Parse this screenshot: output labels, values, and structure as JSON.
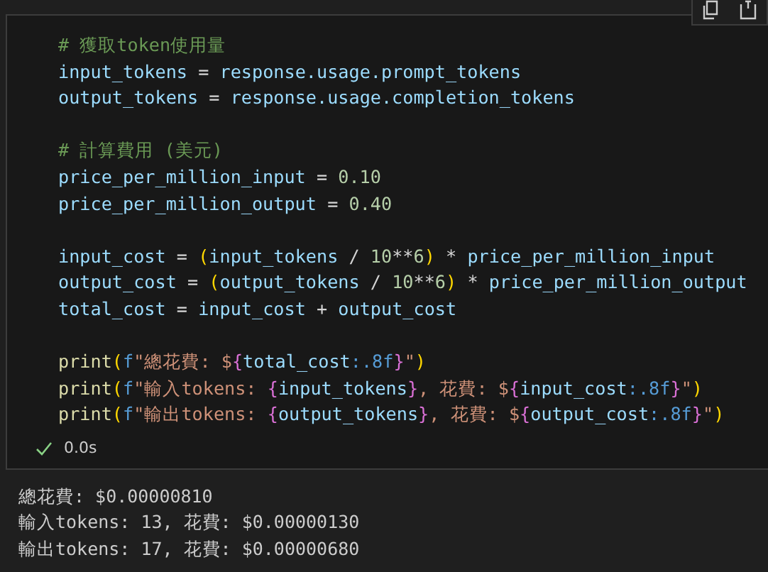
{
  "cell": {
    "blocks": [
      [
        [
          {
            "kind": "comment",
            "text": "# 獲取token使用量"
          }
        ],
        [
          {
            "kind": "name",
            "text": "input_tokens"
          },
          {
            "kind": "op",
            "text": " = "
          },
          {
            "kind": "name",
            "text": "response.usage.prompt_tokens"
          }
        ],
        [
          {
            "kind": "name",
            "text": "output_tokens"
          },
          {
            "kind": "op",
            "text": " = "
          },
          {
            "kind": "name",
            "text": "response.usage.completion_tokens"
          }
        ]
      ],
      [
        [
          {
            "kind": "comment",
            "text": "# 計算費用 (美元)"
          }
        ],
        [
          {
            "kind": "name",
            "text": "price_per_million_input"
          },
          {
            "kind": "op",
            "text": " = "
          },
          {
            "kind": "number",
            "text": "0.10"
          }
        ],
        [
          {
            "kind": "name",
            "text": "price_per_million_output"
          },
          {
            "kind": "op",
            "text": " = "
          },
          {
            "kind": "number",
            "text": "0.40"
          }
        ]
      ],
      [
        [
          {
            "kind": "name",
            "text": "input_cost"
          },
          {
            "kind": "op",
            "text": " = "
          },
          {
            "kind": "paren",
            "text": "("
          },
          {
            "kind": "name",
            "text": "input_tokens"
          },
          {
            "kind": "op",
            "text": " / "
          },
          {
            "kind": "number",
            "text": "10"
          },
          {
            "kind": "op",
            "text": "**"
          },
          {
            "kind": "number",
            "text": "6"
          },
          {
            "kind": "paren",
            "text": ")"
          },
          {
            "kind": "op",
            "text": " * "
          },
          {
            "kind": "name",
            "text": "price_per_million_input"
          }
        ],
        [
          {
            "kind": "name",
            "text": "output_cost"
          },
          {
            "kind": "op",
            "text": " = "
          },
          {
            "kind": "paren",
            "text": "("
          },
          {
            "kind": "name",
            "text": "output_tokens"
          },
          {
            "kind": "op",
            "text": " / "
          },
          {
            "kind": "number",
            "text": "10"
          },
          {
            "kind": "op",
            "text": "**"
          },
          {
            "kind": "number",
            "text": "6"
          },
          {
            "kind": "paren",
            "text": ")"
          },
          {
            "kind": "op",
            "text": " * "
          },
          {
            "kind": "name",
            "text": "price_per_million_output"
          }
        ],
        [
          {
            "kind": "name",
            "text": "total_cost"
          },
          {
            "kind": "op",
            "text": " = "
          },
          {
            "kind": "name",
            "text": "input_cost"
          },
          {
            "kind": "op",
            "text": " + "
          },
          {
            "kind": "name",
            "text": "output_cost"
          }
        ]
      ],
      [
        [
          {
            "kind": "func",
            "text": "print"
          },
          {
            "kind": "paren",
            "text": "("
          },
          {
            "kind": "prefix",
            "text": "f"
          },
          {
            "kind": "string",
            "text": "\"總花費: $"
          },
          {
            "kind": "brace",
            "text": "{"
          },
          {
            "kind": "name",
            "text": "total_cost"
          },
          {
            "kind": "spec",
            "text": ":.8f"
          },
          {
            "kind": "brace",
            "text": "}"
          },
          {
            "kind": "string",
            "text": "\""
          },
          {
            "kind": "paren",
            "text": ")"
          }
        ],
        [
          {
            "kind": "func",
            "text": "print"
          },
          {
            "kind": "paren",
            "text": "("
          },
          {
            "kind": "prefix",
            "text": "f"
          },
          {
            "kind": "string",
            "text": "\"輸入tokens: "
          },
          {
            "kind": "brace",
            "text": "{"
          },
          {
            "kind": "name",
            "text": "input_tokens"
          },
          {
            "kind": "brace",
            "text": "}"
          },
          {
            "kind": "string",
            "text": ", 花費: $"
          },
          {
            "kind": "brace",
            "text": "{"
          },
          {
            "kind": "name",
            "text": "input_cost"
          },
          {
            "kind": "spec",
            "text": ":.8f"
          },
          {
            "kind": "brace",
            "text": "}"
          },
          {
            "kind": "string",
            "text": "\""
          },
          {
            "kind": "paren",
            "text": ")"
          }
        ],
        [
          {
            "kind": "func",
            "text": "print"
          },
          {
            "kind": "paren",
            "text": "("
          },
          {
            "kind": "prefix",
            "text": "f"
          },
          {
            "kind": "string",
            "text": "\"輸出tokens: "
          },
          {
            "kind": "brace",
            "text": "{"
          },
          {
            "kind": "name",
            "text": "output_tokens"
          },
          {
            "kind": "brace",
            "text": "}"
          },
          {
            "kind": "string",
            "text": ", 花費: $"
          },
          {
            "kind": "brace",
            "text": "{"
          },
          {
            "kind": "name",
            "text": "output_cost"
          },
          {
            "kind": "spec",
            "text": ":.8f"
          },
          {
            "kind": "brace",
            "text": "}"
          },
          {
            "kind": "string",
            "text": "\""
          },
          {
            "kind": "paren",
            "text": ")"
          }
        ]
      ]
    ],
    "status": {
      "succeeded": true,
      "duration": "0.0s"
    }
  },
  "output": [
    "總花費: $0.00000810",
    "輸入tokens: 13, 花費: $0.00000130",
    "輸出tokens: 17, 花費: $0.00000680"
  ]
}
